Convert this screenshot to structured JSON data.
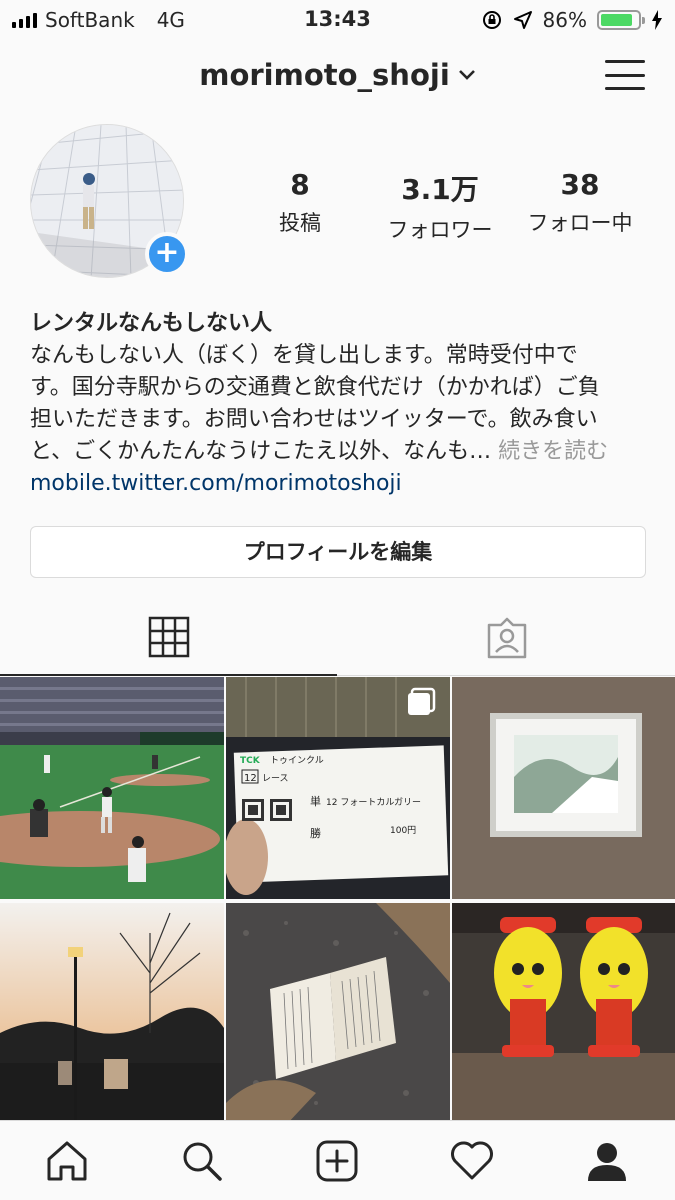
{
  "status_bar": {
    "carrier": "SoftBank",
    "network": "4G",
    "time": "13:43",
    "battery_percent": "86%",
    "battery_level": 0.86,
    "battery_color": "#4cd964"
  },
  "header": {
    "username": "morimoto_shoji",
    "dropdown_icon": "chevron-down-icon",
    "menu_icon": "hamburger-menu-icon"
  },
  "stats": {
    "posts_count": "8",
    "posts_label": "投稿",
    "followers_count": "3.1万",
    "followers_label": "フォロワー",
    "following_count": "38",
    "following_label": "フォロー中"
  },
  "bio": {
    "name": "レンタルなんもしない人",
    "lines": [
      "なんもしない人（ぼく）を貸し出します。常時受付中で",
      "す。国分寺駅からの交通費と飲食代だけ（かかれば）ご負",
      "担いただきます。お問い合わせはツイッターで。飲み食い",
      "と、ごくかんたんなうけこたえ以外、なんも…"
    ],
    "more": "続きを読む",
    "link": "mobile.twitter.com/morimotoshoji"
  },
  "edit_profile_label": "プロフィールを編集",
  "tabs": {
    "grid_icon": "grid-icon",
    "tagged_icon": "tagged-person-icon"
  },
  "accent_color": "#3897f0",
  "link_color": "#003569",
  "ticket": {
    "brand": "トゥインクル",
    "race_no": "12",
    "race_label": "レース",
    "bet_type_1": "単",
    "bet_type_2": "勝",
    "horse": "12 フォートカルガリー",
    "amount": "100円"
  },
  "nav": {
    "home_icon": "home-icon",
    "search_icon": "search-icon",
    "add_icon": "add-post-icon",
    "activity_icon": "heart-icon",
    "profile_icon": "profile-icon"
  }
}
